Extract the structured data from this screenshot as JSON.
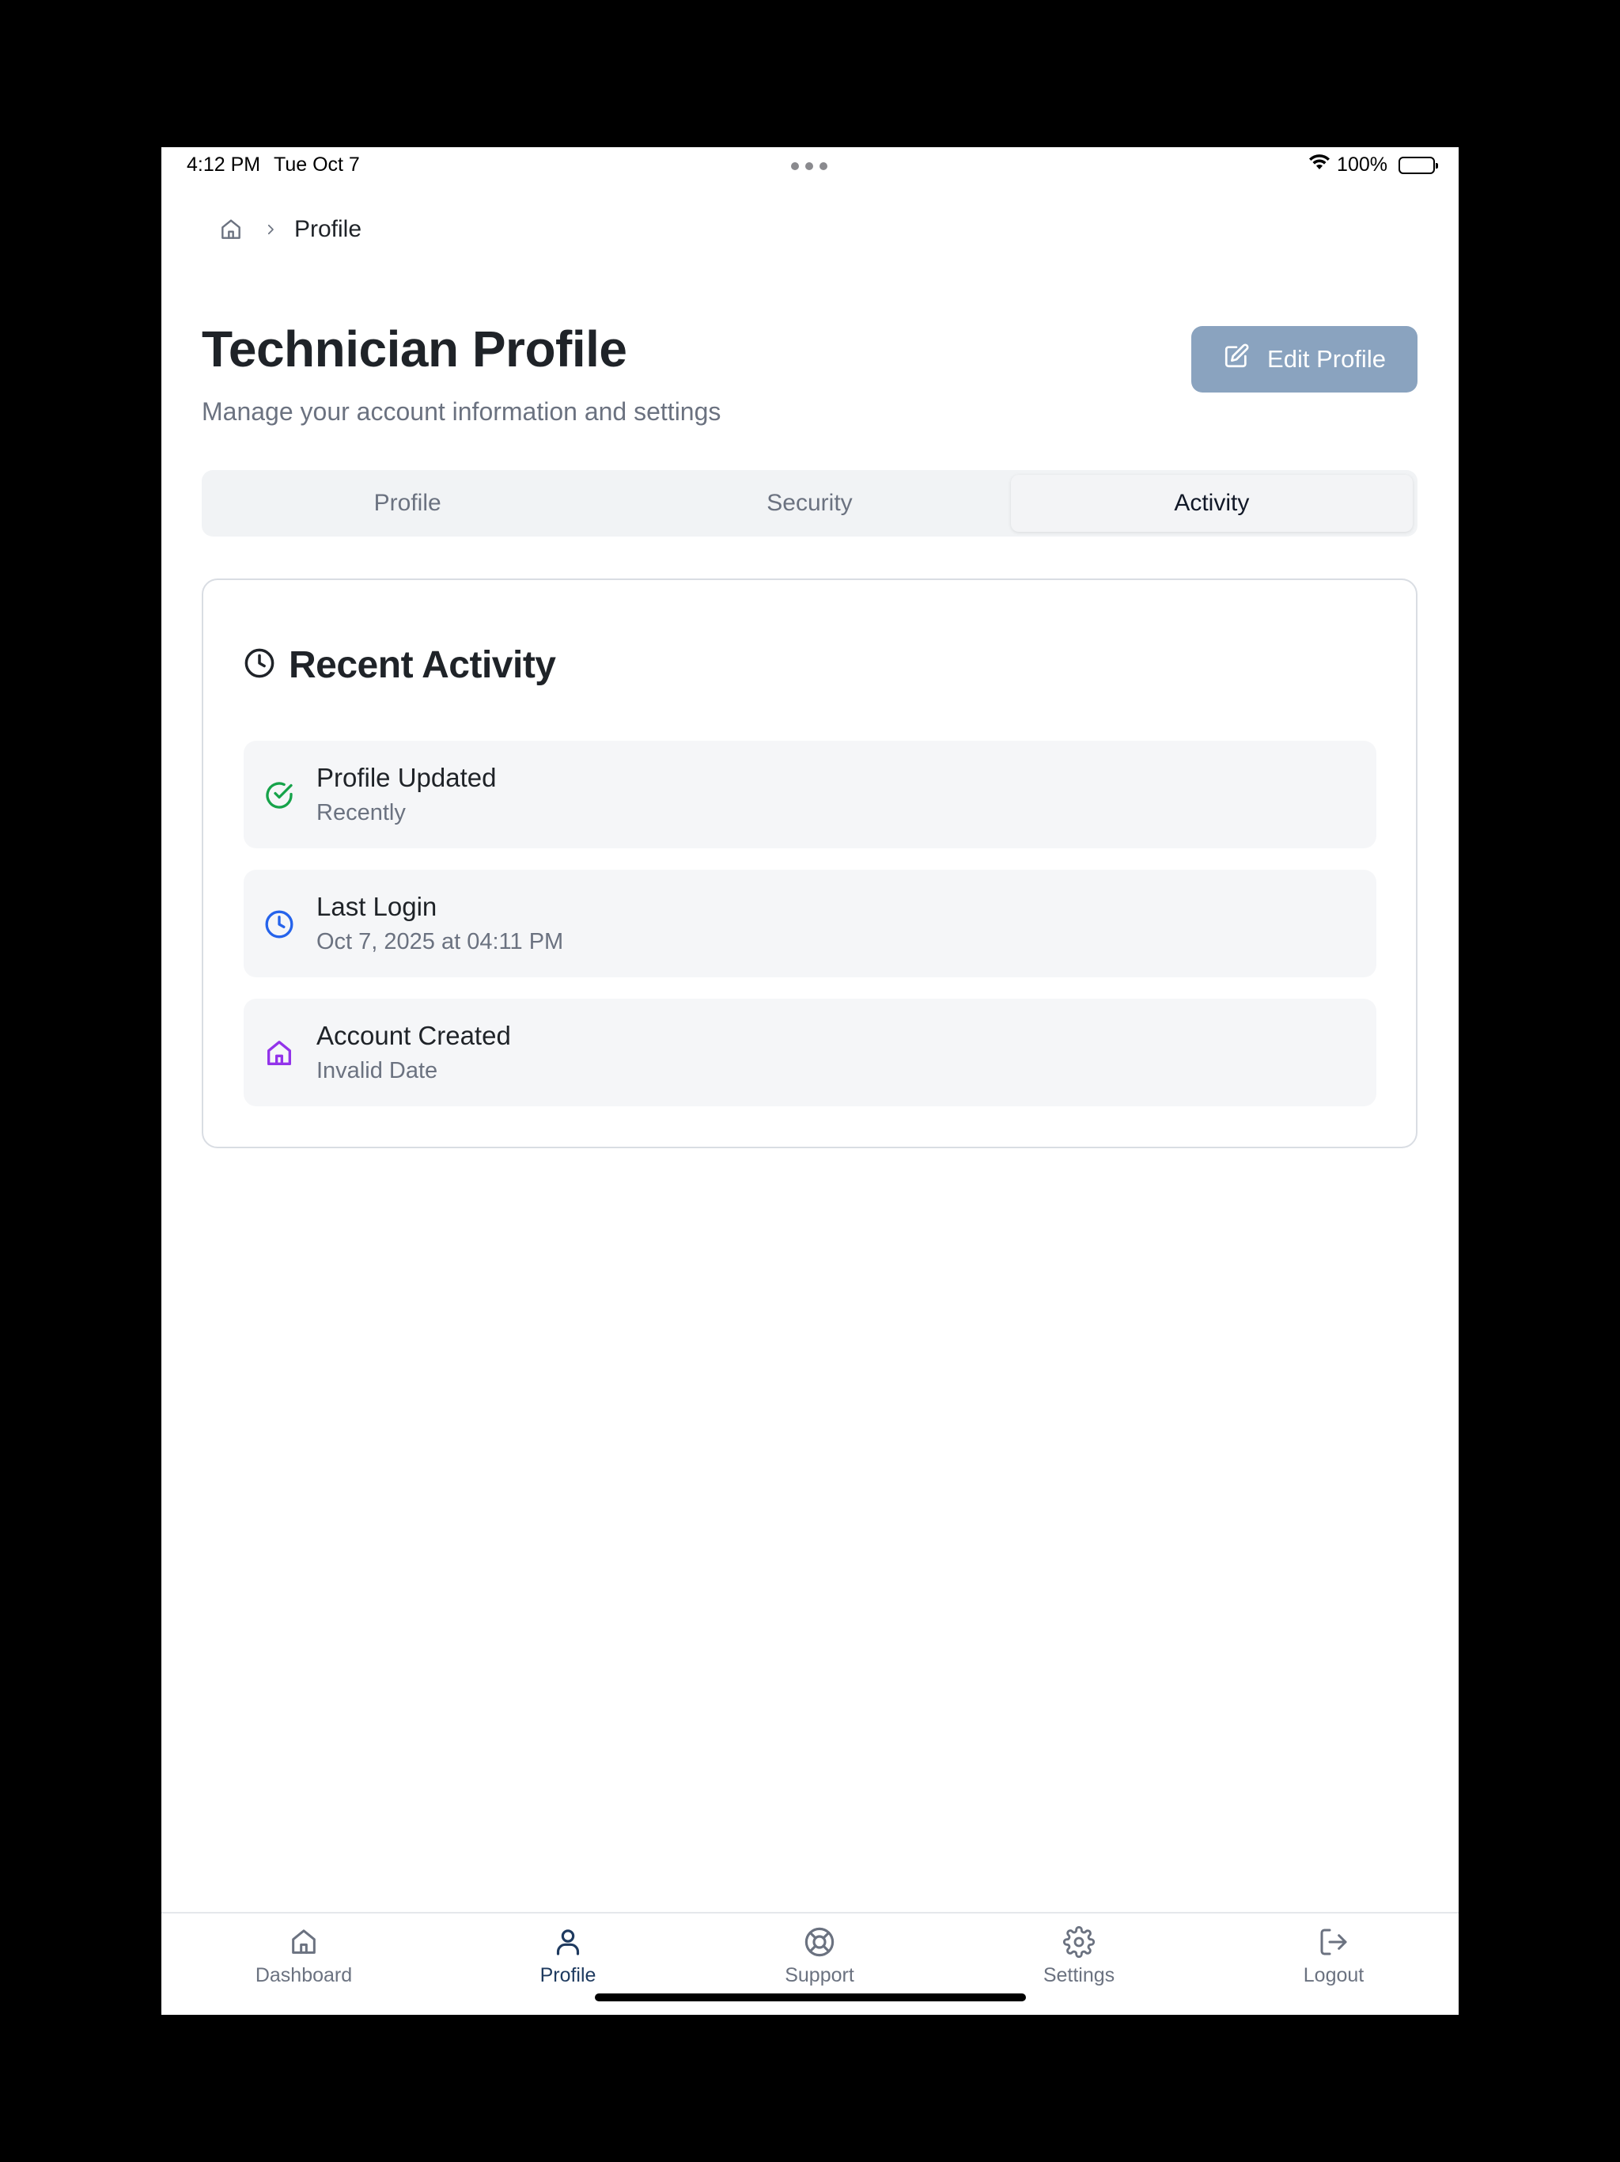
{
  "status_bar": {
    "time": "4:12 PM",
    "date": "Tue Oct 7",
    "battery": "100%"
  },
  "breadcrumb": {
    "home_icon": "home-icon",
    "separator_icon": "chevron-right-icon",
    "current": "Profile"
  },
  "header": {
    "title": "Technician Profile",
    "subtitle": "Manage your account information and settings",
    "edit_button_label": "Edit Profile",
    "edit_button_icon": "edit-icon"
  },
  "tabs": [
    {
      "label": "Profile",
      "active": false
    },
    {
      "label": "Security",
      "active": false
    },
    {
      "label": "Activity",
      "active": true
    }
  ],
  "activity_card": {
    "title": "Recent Activity",
    "icon": "clock-icon",
    "items": [
      {
        "title": "Profile Updated",
        "subtitle": "Recently",
        "icon": "check-circle-icon",
        "color": "#16a34a"
      },
      {
        "title": "Last Login",
        "subtitle": "Oct 7, 2025 at 04:11 PM",
        "icon": "clock-icon",
        "color": "#2563eb"
      },
      {
        "title": "Account Created",
        "subtitle": "Invalid Date",
        "icon": "home-icon",
        "color": "#9333ea"
      }
    ]
  },
  "bottom_nav": [
    {
      "label": "Dashboard",
      "icon": "home-icon",
      "active": false
    },
    {
      "label": "Profile",
      "icon": "user-icon",
      "active": true
    },
    {
      "label": "Support",
      "icon": "lifebuoy-icon",
      "active": false
    },
    {
      "label": "Settings",
      "icon": "gear-icon",
      "active": false
    },
    {
      "label": "Logout",
      "icon": "logout-icon",
      "active": false
    }
  ],
  "colors": {
    "accent": "#1e3a5f",
    "button": "#8aa3bf",
    "muted_text": "#6b7280"
  }
}
